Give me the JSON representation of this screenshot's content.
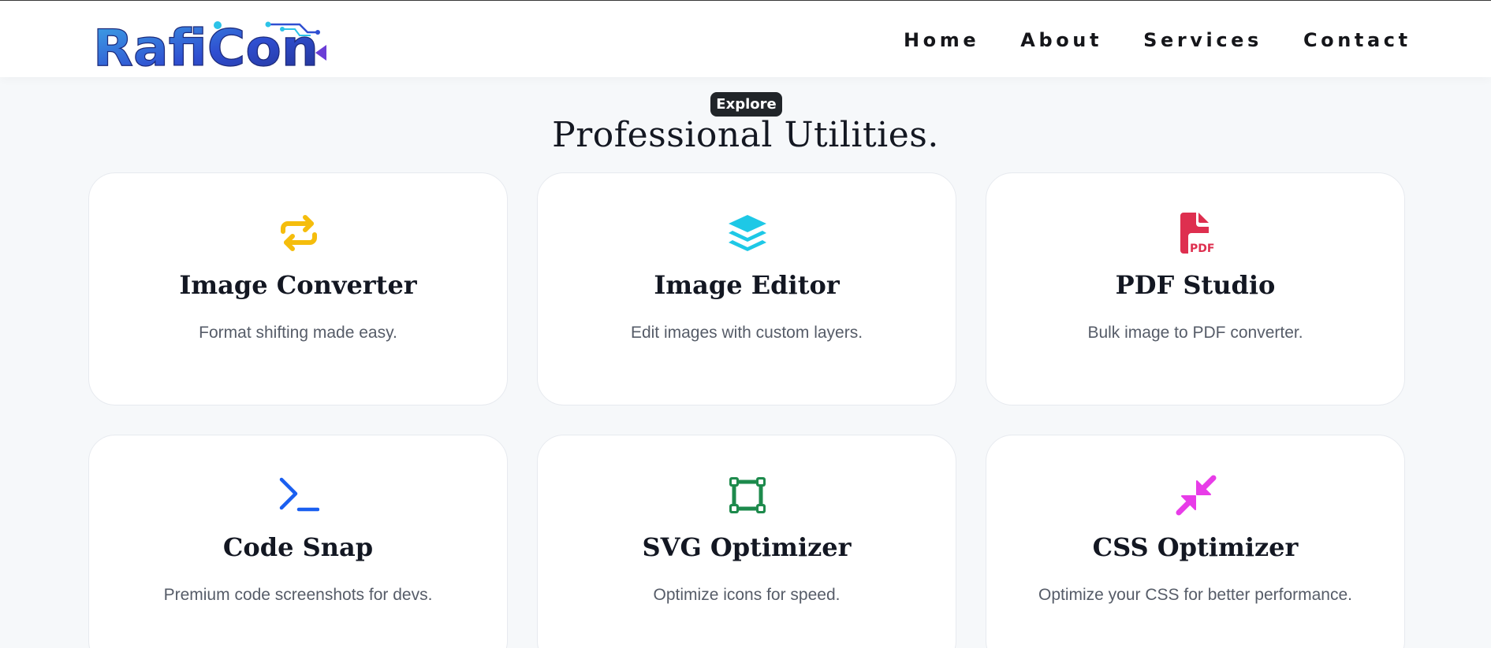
{
  "header": {
    "logo_text": "RafiCon",
    "nav": [
      {
        "label": "Home"
      },
      {
        "label": "About"
      },
      {
        "label": "Services"
      },
      {
        "label": "Contact"
      }
    ]
  },
  "hero": {
    "badge": "Explore",
    "title": "Professional Utilities."
  },
  "colors": {
    "logo_blue": "#2f4fd1",
    "logo_cyan": "#2cc3e8",
    "converter": "#f5bd0c",
    "editor": "#1ec8e6",
    "pdf": "#de2f4f",
    "code": "#1a5ff0",
    "svg": "#1d8a4c",
    "css": "#e83ce8"
  },
  "tools": [
    {
      "icon": "repeat-arrows-icon",
      "title": "Image Converter",
      "description": "Format shifting made easy."
    },
    {
      "icon": "layers-icon",
      "title": "Image Editor",
      "description": "Edit images with custom layers."
    },
    {
      "icon": "pdf-file-icon",
      "title": "PDF Studio",
      "description": "Bulk image to PDF converter."
    },
    {
      "icon": "terminal-icon",
      "title": "Code Snap",
      "description": "Premium code screenshots for devs."
    },
    {
      "icon": "bounding-box-icon",
      "title": "SVG Optimizer",
      "description": "Optimize icons for speed."
    },
    {
      "icon": "compress-arrows-icon",
      "title": "CSS Optimizer",
      "description": "Optimize your CSS for better performance."
    }
  ]
}
